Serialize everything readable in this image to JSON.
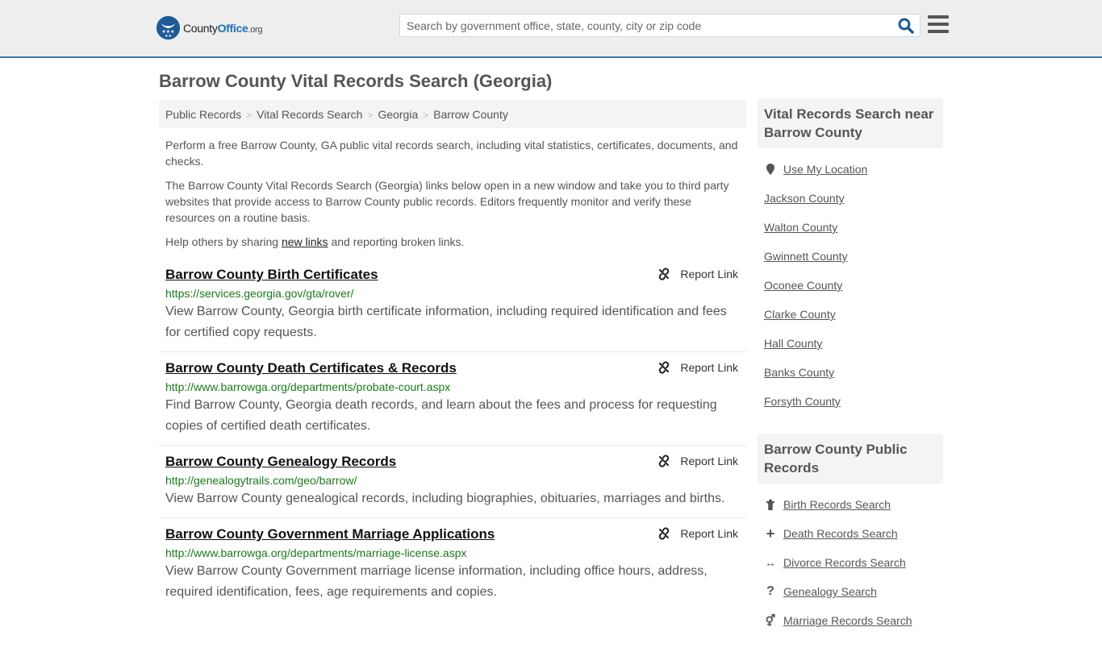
{
  "header": {
    "logo": {
      "county": "County",
      "office": "Office",
      "tld": ".org"
    },
    "search_placeholder": "Search by government office, state, county, city or zip code",
    "search_value": "",
    "search_icon": "search-icon",
    "menu_icon": "hamburger-icon",
    "colors": {
      "brand_blue": "#1d6fb8",
      "header_border": "#3d7aab",
      "url_green": "#1a7a1a"
    }
  },
  "page": {
    "title": "Barrow County Vital Records Search (Georgia)",
    "breadcrumb": [
      "Public Records",
      "Vital Records Search",
      "Georgia",
      "Barrow County"
    ],
    "breadcrumb_separator": ">",
    "intro": {
      "p1": "Perform a free Barrow County, GA public vital records search, including vital statistics, certificates, documents, and checks.",
      "p2": "The Barrow County Vital Records Search (Georgia) links below open in a new window and take you to third party websites that provide access to Barrow County public records. Editors frequently monitor and verify these resources on a routine basis.",
      "p3_before": "Help others by sharing ",
      "p3_link": "new links",
      "p3_after": " and reporting broken links."
    }
  },
  "results": [
    {
      "title": "Barrow County Birth Certificates",
      "url": "https://services.georgia.gov/gta/rover/",
      "description": "View Barrow County, Georgia birth certificate information, including required identification and fees for certified copy requests.",
      "report_label": "Report Link"
    },
    {
      "title": "Barrow County Death Certificates & Records",
      "url": "http://www.barrowga.org/departments/probate-court.aspx",
      "description": "Find Barrow County, Georgia death records, and learn about the fees and process for requesting copies of certified death certificates.",
      "report_label": "Report Link"
    },
    {
      "title": "Barrow County Genealogy Records",
      "url": "http://genealogytrails.com/geo/barrow/",
      "description": "View Barrow County genealogical records, including biographies, obituaries, marriages and births.",
      "report_label": "Report Link"
    },
    {
      "title": "Barrow County Government Marriage Applications",
      "url": "http://www.barrowga.org/departments/marriage-license.aspx",
      "description": "View Barrow County Government marriage license information, including office hours, address, required identification, fees, age requirements and copies.",
      "report_label": "Report Link"
    }
  ],
  "sidebar": {
    "nearby": {
      "heading": "Vital Records Search near Barrow County",
      "location_label": "Use My Location",
      "counties": [
        "Jackson County",
        "Walton County",
        "Gwinnett County",
        "Oconee County",
        "Clarke County",
        "Hall County",
        "Banks County",
        "Forsyth County"
      ]
    },
    "public_records": {
      "heading": "Barrow County Public Records",
      "items": [
        {
          "label": "Birth Records Search",
          "icon": "child-icon",
          "glyph": "Ὣ8"
        },
        {
          "label": "Death Records Search",
          "icon": "plus-icon",
          "glyph": "+"
        },
        {
          "label": "Divorce Records Search",
          "icon": "arrows-horizontal-icon",
          "glyph": "↔"
        },
        {
          "label": "Genealogy Search",
          "icon": "question-icon",
          "glyph": "?"
        },
        {
          "label": "Marriage Records Search",
          "icon": "mars-venus-icon",
          "glyph": "⚥"
        }
      ]
    }
  }
}
